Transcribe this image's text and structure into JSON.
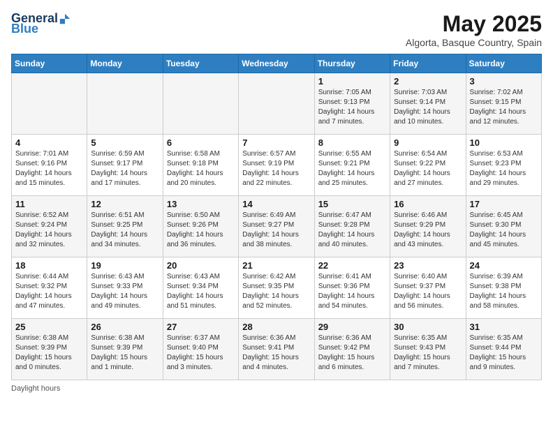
{
  "logo": {
    "general": "General",
    "blue": "Blue"
  },
  "title": "May 2025",
  "subtitle": "Algorta, Basque Country, Spain",
  "weekdays": [
    "Sunday",
    "Monday",
    "Tuesday",
    "Wednesday",
    "Thursday",
    "Friday",
    "Saturday"
  ],
  "weeks": [
    [
      {
        "day": "",
        "info": ""
      },
      {
        "day": "",
        "info": ""
      },
      {
        "day": "",
        "info": ""
      },
      {
        "day": "",
        "info": ""
      },
      {
        "day": "1",
        "info": "Sunrise: 7:05 AM\nSunset: 9:13 PM\nDaylight: 14 hours\nand 7 minutes."
      },
      {
        "day": "2",
        "info": "Sunrise: 7:03 AM\nSunset: 9:14 PM\nDaylight: 14 hours\nand 10 minutes."
      },
      {
        "day": "3",
        "info": "Sunrise: 7:02 AM\nSunset: 9:15 PM\nDaylight: 14 hours\nand 12 minutes."
      }
    ],
    [
      {
        "day": "4",
        "info": "Sunrise: 7:01 AM\nSunset: 9:16 PM\nDaylight: 14 hours\nand 15 minutes."
      },
      {
        "day": "5",
        "info": "Sunrise: 6:59 AM\nSunset: 9:17 PM\nDaylight: 14 hours\nand 17 minutes."
      },
      {
        "day": "6",
        "info": "Sunrise: 6:58 AM\nSunset: 9:18 PM\nDaylight: 14 hours\nand 20 minutes."
      },
      {
        "day": "7",
        "info": "Sunrise: 6:57 AM\nSunset: 9:19 PM\nDaylight: 14 hours\nand 22 minutes."
      },
      {
        "day": "8",
        "info": "Sunrise: 6:55 AM\nSunset: 9:21 PM\nDaylight: 14 hours\nand 25 minutes."
      },
      {
        "day": "9",
        "info": "Sunrise: 6:54 AM\nSunset: 9:22 PM\nDaylight: 14 hours\nand 27 minutes."
      },
      {
        "day": "10",
        "info": "Sunrise: 6:53 AM\nSunset: 9:23 PM\nDaylight: 14 hours\nand 29 minutes."
      }
    ],
    [
      {
        "day": "11",
        "info": "Sunrise: 6:52 AM\nSunset: 9:24 PM\nDaylight: 14 hours\nand 32 minutes."
      },
      {
        "day": "12",
        "info": "Sunrise: 6:51 AM\nSunset: 9:25 PM\nDaylight: 14 hours\nand 34 minutes."
      },
      {
        "day": "13",
        "info": "Sunrise: 6:50 AM\nSunset: 9:26 PM\nDaylight: 14 hours\nand 36 minutes."
      },
      {
        "day": "14",
        "info": "Sunrise: 6:49 AM\nSunset: 9:27 PM\nDaylight: 14 hours\nand 38 minutes."
      },
      {
        "day": "15",
        "info": "Sunrise: 6:47 AM\nSunset: 9:28 PM\nDaylight: 14 hours\nand 40 minutes."
      },
      {
        "day": "16",
        "info": "Sunrise: 6:46 AM\nSunset: 9:29 PM\nDaylight: 14 hours\nand 43 minutes."
      },
      {
        "day": "17",
        "info": "Sunrise: 6:45 AM\nSunset: 9:30 PM\nDaylight: 14 hours\nand 45 minutes."
      }
    ],
    [
      {
        "day": "18",
        "info": "Sunrise: 6:44 AM\nSunset: 9:32 PM\nDaylight: 14 hours\nand 47 minutes."
      },
      {
        "day": "19",
        "info": "Sunrise: 6:43 AM\nSunset: 9:33 PM\nDaylight: 14 hours\nand 49 minutes."
      },
      {
        "day": "20",
        "info": "Sunrise: 6:43 AM\nSunset: 9:34 PM\nDaylight: 14 hours\nand 51 minutes."
      },
      {
        "day": "21",
        "info": "Sunrise: 6:42 AM\nSunset: 9:35 PM\nDaylight: 14 hours\nand 52 minutes."
      },
      {
        "day": "22",
        "info": "Sunrise: 6:41 AM\nSunset: 9:36 PM\nDaylight: 14 hours\nand 54 minutes."
      },
      {
        "day": "23",
        "info": "Sunrise: 6:40 AM\nSunset: 9:37 PM\nDaylight: 14 hours\nand 56 minutes."
      },
      {
        "day": "24",
        "info": "Sunrise: 6:39 AM\nSunset: 9:38 PM\nDaylight: 14 hours\nand 58 minutes."
      }
    ],
    [
      {
        "day": "25",
        "info": "Sunrise: 6:38 AM\nSunset: 9:39 PM\nDaylight: 15 hours\nand 0 minutes."
      },
      {
        "day": "26",
        "info": "Sunrise: 6:38 AM\nSunset: 9:39 PM\nDaylight: 15 hours\nand 1 minute."
      },
      {
        "day": "27",
        "info": "Sunrise: 6:37 AM\nSunset: 9:40 PM\nDaylight: 15 hours\nand 3 minutes."
      },
      {
        "day": "28",
        "info": "Sunrise: 6:36 AM\nSunset: 9:41 PM\nDaylight: 15 hours\nand 4 minutes."
      },
      {
        "day": "29",
        "info": "Sunrise: 6:36 AM\nSunset: 9:42 PM\nDaylight: 15 hours\nand 6 minutes."
      },
      {
        "day": "30",
        "info": "Sunrise: 6:35 AM\nSunset: 9:43 PM\nDaylight: 15 hours\nand 7 minutes."
      },
      {
        "day": "31",
        "info": "Sunrise: 6:35 AM\nSunset: 9:44 PM\nDaylight: 15 hours\nand 9 minutes."
      }
    ]
  ],
  "footer": "Daylight hours"
}
